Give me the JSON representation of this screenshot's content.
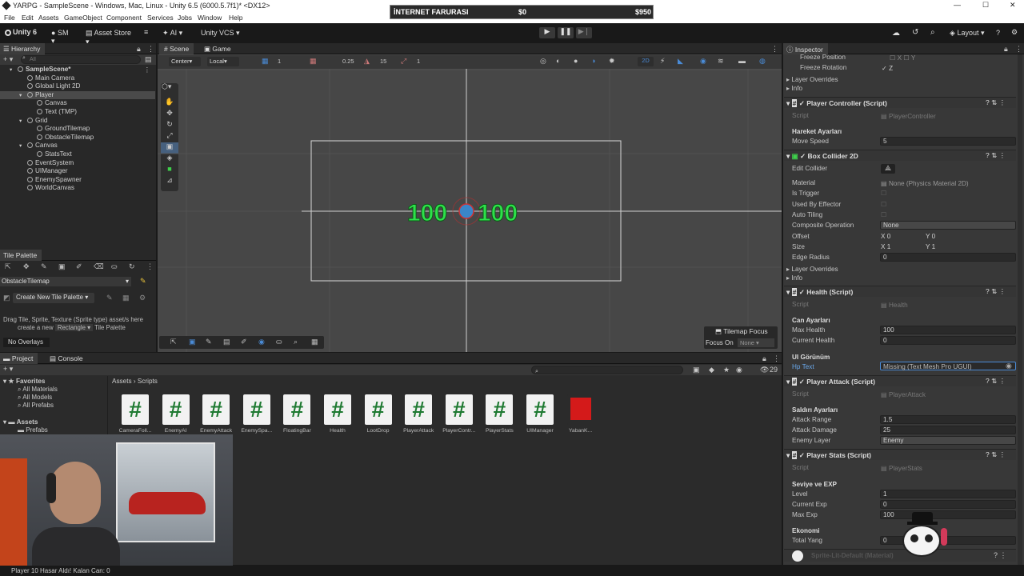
{
  "window": {
    "title": "YARPG - SampleScene - Windows, Mac, Linux - Unity 6.5 (6000.5.7f1)* <DX12>",
    "minimize": "—",
    "maximize": "☐",
    "close": "✕"
  },
  "menu": [
    "File",
    "Edit",
    "Assets",
    "GameObject",
    "Component",
    "Services",
    "Jobs",
    "Window",
    "Help"
  ],
  "game_overlay": {
    "title": "İNTERNET FARURASI",
    "amount": "$0",
    "total": "$950"
  },
  "toolbar": {
    "unity": "Unity 6",
    "account": "SM",
    "asset_store": "Asset Store",
    "ai": "AI",
    "vcs": "Unity VCS",
    "layout": "Layout"
  },
  "hierarchy": {
    "tab": "Hierarchy",
    "search_placeholder": "All",
    "items": [
      {
        "label": "SampleScene*",
        "depth": 0,
        "bold": true
      },
      {
        "label": "Main Camera",
        "depth": 1
      },
      {
        "label": "Global Light 2D",
        "depth": 1
      },
      {
        "label": "Player",
        "depth": 1,
        "selected": true
      },
      {
        "label": "Canvas",
        "depth": 2
      },
      {
        "label": "Text (TMP)",
        "depth": 2
      },
      {
        "label": "Grid",
        "depth": 1
      },
      {
        "label": "GroundTilemap",
        "depth": 2
      },
      {
        "label": "ObstacleTilemap",
        "depth": 2
      },
      {
        "label": "Canvas",
        "depth": 1
      },
      {
        "label": "StatsText",
        "depth": 2
      },
      {
        "label": "EventSystem",
        "depth": 1
      },
      {
        "label": "UIManager",
        "depth": 1
      },
      {
        "label": "EnemySpawner",
        "depth": 1
      },
      {
        "label": "WorldCanvas",
        "depth": 1
      }
    ]
  },
  "tile_palette": {
    "tab": "Tile Palette",
    "target": "ObstacleTilemap",
    "create_btn": "Create New Tile Palette",
    "drag_text": "Drag Tile, Sprite, Texture (Sprite type) asset/s here",
    "create_text": "create a new",
    "create_type": "Rectangle",
    "create_suffix": "Tile Palette",
    "no_overlays": "No Overlays"
  },
  "scene": {
    "tab_scene": "Scene",
    "tab_game": "Game",
    "pivot": "Center",
    "space": "Local",
    "grid_value": "1",
    "snap_value": "0.25",
    "rot_value": "15",
    "scale_value": "1",
    "mode_2d": "2D",
    "hp_left": "100",
    "hp_right": "100",
    "tilemap_focus": "Tilemap Focus",
    "focus_on": "Focus On",
    "focus_none": "None"
  },
  "project": {
    "tab_project": "Project",
    "tab_console": "Console",
    "favorites": "Favorites",
    "fav_items": [
      "All Materials",
      "All Models",
      "All Prefabs"
    ],
    "assets": "Assets",
    "assets_items": [
      "Prefabs"
    ],
    "breadcrumb_root": "Assets",
    "breadcrumb_sep": "›",
    "breadcrumb_leaf": "Scripts",
    "count": "29",
    "files": [
      "CameraFoll...",
      "EnemyAI",
      "EnemyAttack",
      "EnemySpa...",
      "FloatingBar",
      "Health",
      "LootDrop",
      "PlayerAttack",
      "PlayerContr...",
      "PlayerStats",
      "UIManager",
      "YabanK..."
    ]
  },
  "status_bar": "Player 10 Hasar Aldı! Kalan Can: 0",
  "inspector": {
    "tab": "Inspector",
    "freeze_position": "Freeze Position",
    "freeze_x": "X",
    "freeze_y": "Y",
    "freeze_rotation": "Freeze Rotation",
    "freeze_z": "Z",
    "layer_overrides": "Layer Overrides",
    "info": "Info",
    "player_controller": {
      "title": "Player Controller (Script)",
      "script_label": "Script",
      "script": "PlayerController",
      "header": "Hareket Ayarları",
      "move_speed_label": "Move Speed",
      "move_speed": "5"
    },
    "box_collider": {
      "title": "Box Collider 2D",
      "edit_collider": "Edit Collider",
      "material_label": "Material",
      "material": "None (Physics Material 2D)",
      "is_trigger": "Is Trigger",
      "used_by_effector": "Used By Effector",
      "auto_tiling": "Auto Tiling",
      "composite_label": "Composite Operation",
      "composite": "None",
      "offset_label": "Offset",
      "offset_x": "0",
      "offset_y": "0",
      "size_label": "Size",
      "size_x": "1",
      "size_y": "1",
      "edge_radius_label": "Edge Radius",
      "edge_radius": "0",
      "layer_overrides": "Layer Overrides",
      "info": "Info"
    },
    "health": {
      "title": "Health (Script)",
      "script_label": "Script",
      "script": "Health",
      "header": "Can Ayarları",
      "max_health_label": "Max Health",
      "max_health": "100",
      "current_health_label": "Current Health",
      "current_health": "0",
      "ui_header": "UI Görünüm",
      "hp_text_label": "Hp Text",
      "hp_text": "Missing (Text Mesh Pro UGUI)"
    },
    "player_attack": {
      "title": "Player Attack (Script)",
      "script_label": "Script",
      "script": "PlayerAttack",
      "header": "Saldırı Ayarları",
      "range_label": "Attack Range",
      "range": "1.5",
      "damage_label": "Attack Damage",
      "damage": "25",
      "layer_label": "Enemy Layer",
      "layer": "Enemy"
    },
    "player_stats": {
      "title": "Player Stats (Script)",
      "script_label": "Script",
      "script": "PlayerStats",
      "header": "Seviye ve EXP",
      "level_label": "Level",
      "level": "1",
      "current_exp_label": "Current Exp",
      "current_exp": "0",
      "max_exp_label": "Max Exp",
      "max_exp": "100",
      "eco_header": "Ekonomi",
      "total_yang_label": "Total Yang",
      "total_yang": "0"
    },
    "material_footer": "Sprite-Lit-Default (Material)"
  },
  "colors": {
    "accent": "#4a8bd6",
    "green_text": "#2ee04a",
    "script_green": "#1f7a32",
    "red_asset": "#d41a1a"
  }
}
